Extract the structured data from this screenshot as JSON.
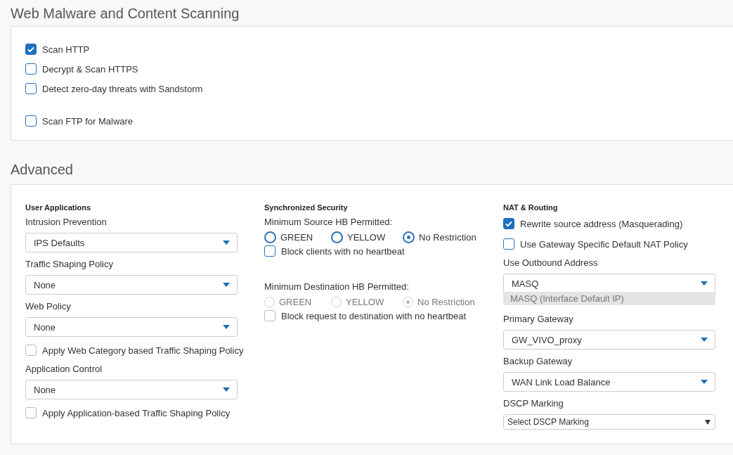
{
  "web_scanning": {
    "title": "Web Malware and Content Scanning",
    "groups": [
      [
        {
          "label": "Scan HTTP",
          "checked": true
        },
        {
          "label": "Decrypt & Scan HTTPS",
          "checked": false
        },
        {
          "label": "Detect zero-day threats with Sandstorm",
          "checked": false
        }
      ],
      [
        {
          "label": "Scan FTP for Malware",
          "checked": false
        }
      ]
    ]
  },
  "advanced": {
    "title": "Advanced",
    "columns": [
      {
        "heading": "User Applications",
        "items": [
          {
            "kind": "select",
            "label": "Intrusion Prevention",
            "value": "IPS Defaults"
          },
          {
            "kind": "select",
            "label": "Traffic Shaping Policy",
            "value": "None"
          },
          {
            "kind": "select",
            "label": "Web Policy",
            "value": "None"
          },
          {
            "kind": "checkbox",
            "label": "Apply Web Category based Traffic Shaping Policy",
            "checked": false,
            "disabled": true
          },
          {
            "kind": "select",
            "label": "Application Control",
            "value": "None"
          },
          {
            "kind": "checkbox",
            "label": "Apply Application-based Traffic Shaping Policy",
            "checked": false,
            "disabled": true
          }
        ]
      },
      {
        "heading": "Synchronized Security",
        "items": [
          {
            "kind": "radio_group",
            "label": "Minimum Source HB Permitted:",
            "disabled": false,
            "options": [
              {
                "label": "GREEN",
                "selected": false
              },
              {
                "label": "YELLOW",
                "selected": false
              },
              {
                "label": "No Restriction",
                "selected": true
              }
            ]
          },
          {
            "kind": "checkbox",
            "label": "Block clients with no heartbeat",
            "checked": false,
            "disabled": false
          },
          {
            "kind": "radio_group",
            "label": "Minimum Destination HB Permitted:",
            "disabled": true,
            "options": [
              {
                "label": "GREEN",
                "selected": false
              },
              {
                "label": "YELLOW",
                "selected": false
              },
              {
                "label": "No Restriction",
                "selected": true
              }
            ]
          },
          {
            "kind": "checkbox",
            "label": "Block request to destination with no heartbeat",
            "checked": false,
            "disabled": true
          }
        ]
      },
      {
        "heading": "NAT & Routing",
        "items": [
          {
            "kind": "checkbox",
            "label": "Rewrite source address (Masquerading)",
            "checked": true,
            "disabled": false
          },
          {
            "kind": "checkbox",
            "label": "Use Gateway Specific Default NAT Policy",
            "checked": false,
            "disabled": false
          },
          {
            "kind": "select",
            "label": "Use Outbound Address",
            "value": "MASQ",
            "note": "MASQ (Interface Default IP)"
          },
          {
            "kind": "select",
            "label": "Primary Gateway",
            "value": "GW_VIVO_proxy"
          },
          {
            "kind": "select",
            "label": "Backup Gateway",
            "value": "WAN Link Load Balance"
          },
          {
            "kind": "native_select",
            "label": "DSCP Marking",
            "value": "Select DSCP Marking"
          }
        ]
      }
    ]
  }
}
